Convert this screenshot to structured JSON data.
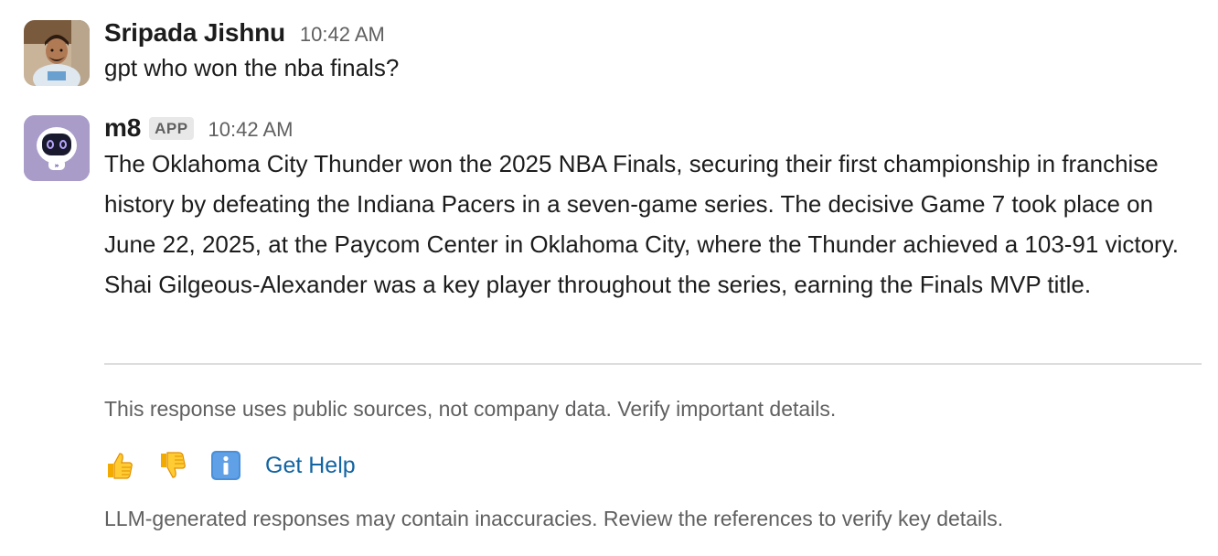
{
  "messages": [
    {
      "sender": "Sripada Jishnu",
      "time": "10:42 AM",
      "text": "gpt who won the nba finals?",
      "avatar_icon": "user-photo-avatar"
    },
    {
      "sender": "m8",
      "badge": "APP",
      "time": "10:42 AM",
      "text": "The Oklahoma City Thunder won the 2025 NBA Finals, securing their first championship in franchise history by defeating the Indiana Pacers in a seven-game series. The decisive Game 7 took place on June 22, 2025, at the Paycom Center in Oklahoma City, where the Thunder achieved a 103-91 victory. Shai Gilgeous-Alexander was a key player throughout the series, earning the Finals MVP title.",
      "avatar_icon": "robot-bot-avatar",
      "avatar_color": "#a99cc9"
    }
  ],
  "sources_notice": "This response uses public sources, not company data. Verify important details.",
  "actions": {
    "thumbs_up_icon": "thumbs-up-icon",
    "thumbs_down_icon": "thumbs-down-icon",
    "info_icon": "info-icon",
    "get_help_label": "Get Help",
    "link_color": "#1264a3"
  },
  "llm_notice": "LLM-generated responses may contain inaccuracies. Review the references to verify key details."
}
